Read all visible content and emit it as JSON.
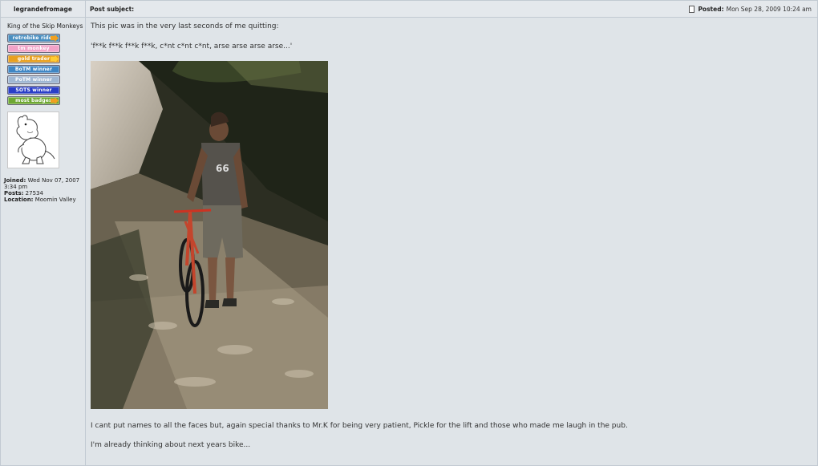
{
  "header": {
    "author": "legrandefromage",
    "subject_label": "Post subject:",
    "posted_label": "Posted:",
    "posted_date": "Mon Sep 28, 2009 10:24 am"
  },
  "profile": {
    "rank": "King of the Skip Monkeys",
    "badges": [
      {
        "label": "retrobike rider",
        "color": "#4a8fc0"
      },
      {
        "label": "tm monkey",
        "color": "#f2a3c8"
      },
      {
        "label": "gold trader",
        "color": "#e8a020"
      },
      {
        "label": "BoTM winner",
        "color": "#3f86c4"
      },
      {
        "label": "PoTM winner",
        "color": "#9fb7d3"
      },
      {
        "label": "SOTS winner",
        "color": "#2a3ec8"
      },
      {
        "label": "most badges",
        "color": "#6ea832"
      }
    ],
    "joined_label": "Joined:",
    "joined_value": "Wed Nov 07, 2007",
    "joined_time": "3:34 pm",
    "posts_label": "Posts:",
    "posts_value": "27534",
    "location_label": "Location:",
    "location_value": "Moomin Valley",
    "avatar_icon": "moomin-avatar"
  },
  "post": {
    "line1": "This pic was in the very last seconds of me quitting:",
    "line2": "'f**k f**k f**k f**k, c*nt c*nt c*nt, arse arse arse arse...'",
    "line3": "I cant put names to all the faces but, again special thanks to Mr.K for being very patient, Pickle for the lift and those who made me laugh in the pub.",
    "line4": "I'm already thinking about next years bike..."
  }
}
